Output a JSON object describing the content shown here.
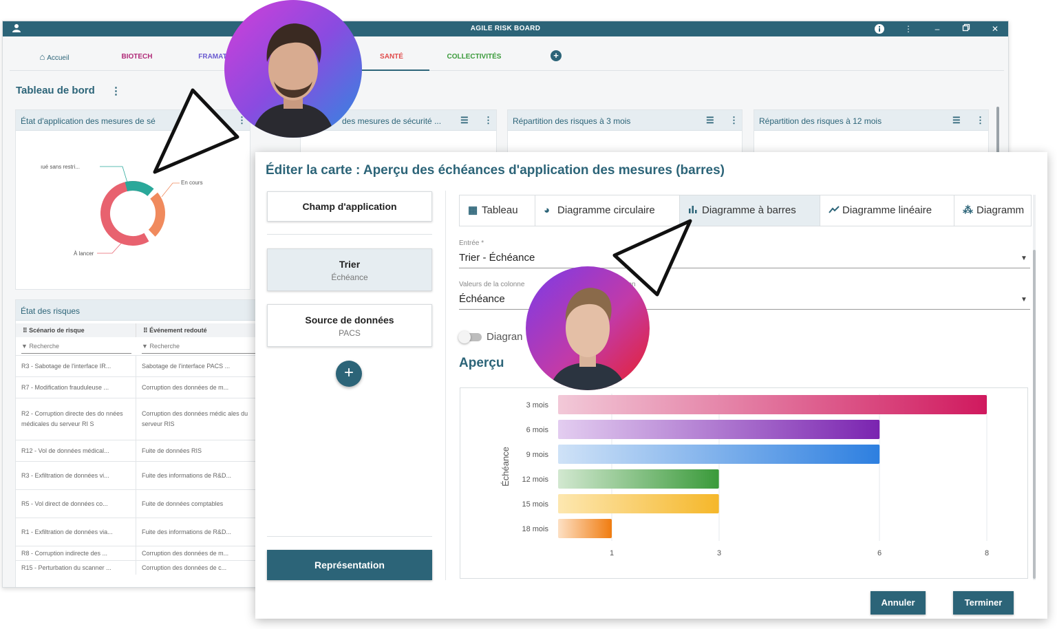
{
  "window": {
    "title": "AGILE RISK BOARD",
    "user_icon": "user-icon",
    "controls": [
      "info-icon",
      "more-vertical-icon",
      "minimize-icon",
      "restore-icon",
      "close-icon"
    ]
  },
  "navtabs": [
    {
      "label": "Accueil",
      "icon": "home-icon",
      "color": "#2c6478"
    },
    {
      "label": "BIOTECH",
      "color": "#b02a78"
    },
    {
      "label": "FRAMAT",
      "color": "#6a5bd0"
    },
    {
      "label": "SANTÉ",
      "color": "#e04b4b"
    },
    {
      "label": "COLLECTIVITÉS",
      "color": "#3a9a3a"
    }
  ],
  "dashboard": {
    "title": "Tableau de bord",
    "cards": [
      {
        "title": "État d'application des mesures de sé"
      },
      {
        "title": "des mesures de sécurité ..."
      },
      {
        "title": "Répartition des risques à 3 mois"
      },
      {
        "title": "Répartition des risques à 12 mois"
      }
    ],
    "donut": {
      "labels": [
        "ıué sans restri...",
        "En cours",
        "À lancer"
      ],
      "colors": [
        "#2aa89a",
        "#f08a5d",
        "#e8626f"
      ]
    }
  },
  "risk_table": {
    "title": "État des risques",
    "columns": [
      "Scénario de risque",
      "Événement redouté"
    ],
    "filter_placeholder": "Recherche",
    "rows": [
      [
        "R3 - Sabotage de l'interface IR...",
        "Sabotage de l'interface PACS ..."
      ],
      [
        "R7 - Modification frauduleuse ...",
        "Corruption des données de m..."
      ],
      [
        "R2 - Corruption directe des do nnées médicales du serveur RI S",
        "Corruption des données médic ales du serveur RIS"
      ],
      [
        "R12 - Vol de données médical...",
        "Fuite de données RIS"
      ],
      [
        "R3 - Exfiltration de données vi...",
        "Fuite des informations de R&D..."
      ],
      [
        "R5 - Vol direct de données co...",
        "Fuite de données comptables"
      ],
      [
        "R1 - Exfiltration de données via...",
        "Fuite des informations de R&D..."
      ],
      [
        "R8 - Corruption indirecte des ...",
        "Corruption des données de m..."
      ],
      [
        "R15 - Perturbation du scanner ...",
        "Corruption des données de c..."
      ]
    ]
  },
  "dialog": {
    "title": "Éditer la carte : Aperçu des échéances d'application des mesures (barres)",
    "side": {
      "scope": "Champ d'application",
      "sort_label": "Trier",
      "sort_value": "Échéance",
      "source_label": "Source de données",
      "source_value": "PACS",
      "add": "+",
      "representation": "Représentation"
    },
    "tabs": [
      {
        "label": "Tableau",
        "icon": "table-icon"
      },
      {
        "label": "Diagramme circulaire",
        "icon": "pie-chart-icon"
      },
      {
        "label": "Diagramme à barres",
        "icon": "bar-chart-icon"
      },
      {
        "label": "Diagramme linéaire",
        "icon": "line-chart-icon"
      },
      {
        "label": "Diagramm",
        "icon": "scatter-chart-icon"
      }
    ],
    "entry": {
      "label": "Entrée *",
      "value": "Trier - Échéance"
    },
    "column": {
      "label": "Valeurs de la colonne",
      "label_tail": "nn",
      "value": "Échéance"
    },
    "toggle_label": "Diagran",
    "preview_title": "Aperçu",
    "cancel": "Annuler",
    "finish": "Terminer"
  },
  "chart_data": {
    "type": "bar",
    "orientation": "horizontal",
    "ylabel": "Échéance",
    "categories": [
      "3 mois",
      "6 mois",
      "9 mois",
      "12 mois",
      "15 mois",
      "18 mois"
    ],
    "values": [
      8,
      6,
      6,
      3,
      3,
      1
    ],
    "xticks": [
      1,
      3,
      6,
      8
    ],
    "colors": [
      [
        "#f2c9d8",
        "#d0195e"
      ],
      [
        "#e3cdf0",
        "#7a24b0"
      ],
      [
        "#cfe2f7",
        "#2d7fe0"
      ],
      [
        "#d2e8d0",
        "#3a9a3a"
      ],
      [
        "#fde7b0",
        "#f5b72a"
      ],
      [
        "#fde0c4",
        "#f07c10"
      ]
    ]
  }
}
